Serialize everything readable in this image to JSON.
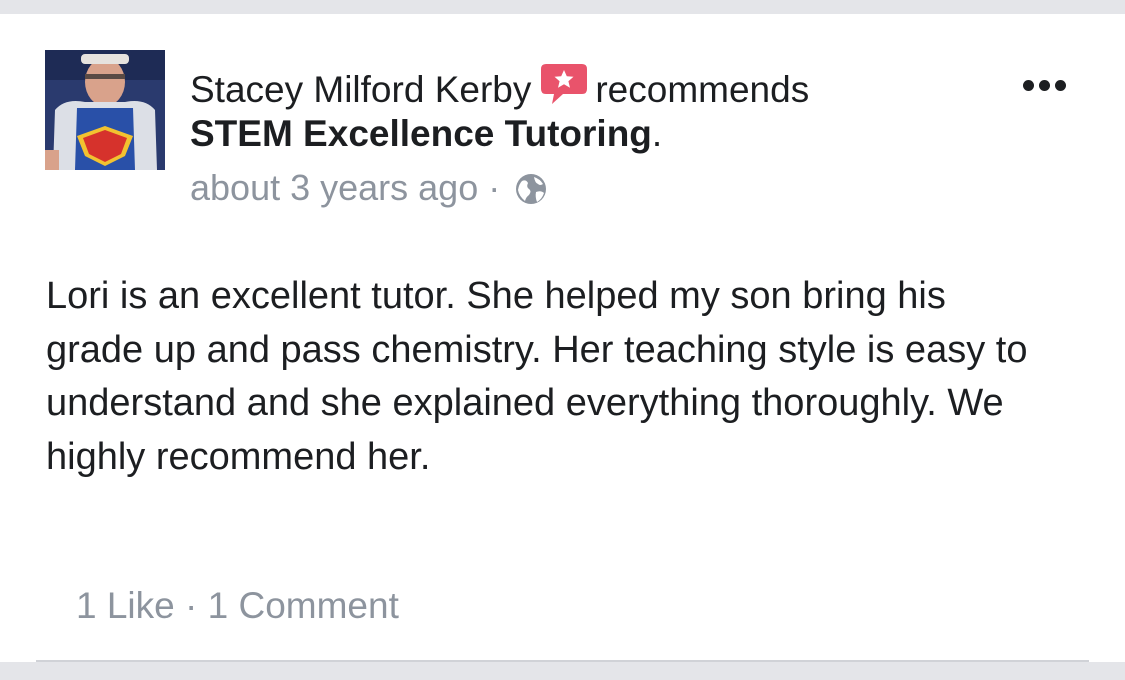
{
  "post": {
    "author_name": "Stacey Milford Kerby",
    "action": "recommends",
    "page_name": "STEM Excellence Tutoring",
    "page_suffix": ".",
    "timestamp": "about 3 years ago",
    "separator": "·",
    "privacy_icon": "globe-icon",
    "recommend_icon": "recommend-badge-icon",
    "more_icon": "more-options-icon",
    "body": "Lori is an excellent tutor. She helped my son bring his grade up and pass chemistry. Her teaching style is easy to understand and she explained everything thoroughly. We highly recommend her."
  },
  "footer": {
    "likes": "1 Like",
    "separator": "·",
    "comments": "1 Comment"
  },
  "colors": {
    "text_primary": "#1c1e21",
    "text_secondary": "#8d949e",
    "recommend_badge": "#e9536b",
    "page_background": "#e4e5e9",
    "card_background": "#ffffff"
  }
}
